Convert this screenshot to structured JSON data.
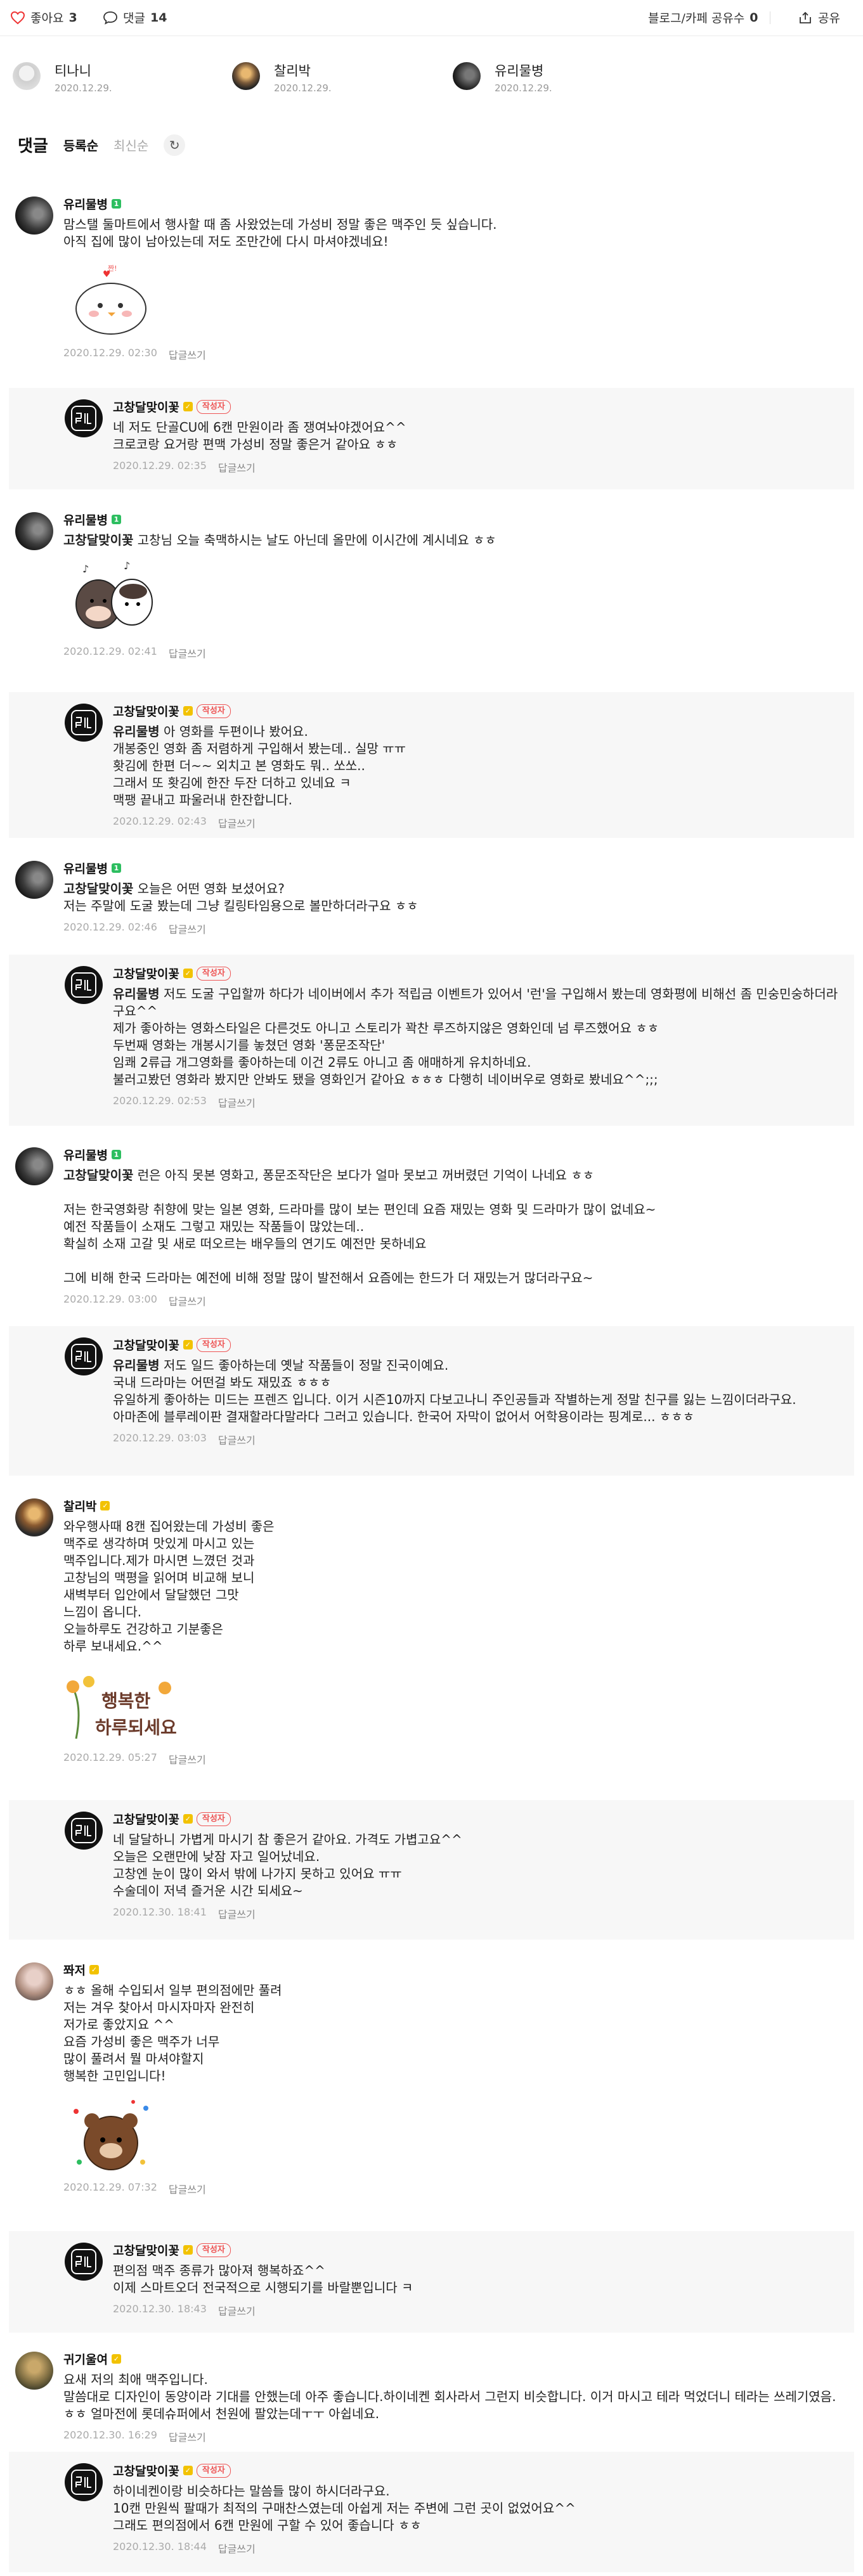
{
  "topbar": {
    "like_label": "좋아요",
    "like_count": "3",
    "comment_label": "댓글",
    "comment_count": "14",
    "share_blog_label": "블로그/카페 공유수",
    "share_blog_count": "0",
    "share_label": "공유"
  },
  "likers": [
    {
      "name": "티나니",
      "date": "2020.12.29."
    },
    {
      "name": "찰리박",
      "date": "2020.12.29."
    },
    {
      "name": "유리물병",
      "date": "2020.12.29."
    }
  ],
  "comments_header": {
    "title": "댓글",
    "sort_active": "등록순",
    "sort_inactive": "최신순"
  },
  "author_badge": "작성자",
  "reply_label": "답글쓰기",
  "comments": [
    {
      "name": "유리물병",
      "text": "맘스탤 둘마트에서 행사할 때 좀 사왔었는데 가성비 정말 좋은 맥주인 듯 싶습니다.\n아직 집에 많이 남아있는데 저도 조만간에 다시 마셔야겠네요!",
      "time": "2020.12.29. 02:30"
    },
    {
      "name": "고창달맞이꽃",
      "text": "네 저도 단골CU에 6캔 만원이라 좀 쟁여놔야겠어요^^\n크로코랑 요거랑 편맥 가성비 정말 좋은거 같아요 ㅎㅎ",
      "time": "2020.12.29. 02:35"
    },
    {
      "name": "유리물병",
      "mention": "고창달맞이꽃",
      "text": " 고창님 오늘 축맥하시는 날도 아닌데 올만에 이시간에 계시네요 ㅎㅎ",
      "time": "2020.12.29. 02:41"
    },
    {
      "name": "고창달맞이꽃",
      "mention": "유리물병",
      "text": " 아 영화를 두편이나 봤어요.\n개봉중인 영화 좀 저렴하게 구입해서 봤는데.. 실망 ㅠㅠ\n홧김에 한편 더~~ 외치고 본 영화도 뭐.. 쏘쏘..\n그래서 또 홧김에 한잔 두잔 더하고 있네요 ㅋ\n맥팽 끝내고 파울러내 한잔합니다.",
      "time": "2020.12.29. 02:43"
    },
    {
      "name": "유리물병",
      "mention": "고창달맞이꽃",
      "text": " 오늘은 어떤 영화 보셨어요?\n저는 주말에 도굴 봤는데 그냥 킬링타임용으로 볼만하더라구요 ㅎㅎ",
      "time": "2020.12.29. 02:46"
    },
    {
      "name": "고창달맞이꽃",
      "mention": "유리물병",
      "text": " 저도 도굴 구입할까 하다가 네이버에서 추가 적립금 이벤트가 있어서 '런'을 구입해서 봤는데 영화평에 비해선 좀 민숭민숭하더라구요^^\n제가 좋아하는 영화스타일은 다른것도 아니고 스토리가 꽉찬 루즈하지않은 영화인데 넘 루즈했어요 ㅎㅎ\n두번째 영화는 개봉시기를 놓쳤던 영화 '퐁문조작단'\n임쾌 2류급 개그영화를 좋아하는데 이건 2류도 아니고 좀 애매하게 유치하네요.\n불러고봤던 영화라 봤지만 안봐도 됐을 영화인거 같아요 ㅎㅎㅎ 다행히 네이버우로 영화로 봤네요^^;;;",
      "time": "2020.12.29. 02:53"
    },
    {
      "name": "유리물병",
      "mention": "고창달맞이꽃",
      "text": " 런은 아직 못본 영화고, 퐁문조작단은 보다가 얼마 못보고 꺼버렸던 기억이 나네요 ㅎㅎ\n\n저는 한국영화랑 취향에 맞는 일본 영화, 드라마를 많이 보는 편인데 요즘 재밌는 영화 및 드라마가 많이 없네요~\n예전 작품들이 소재도 그렇고 재밌는 작품들이 많았는데..\n확실히 소재 고갈 및 새로 떠오르는 배우들의 연기도 예전만 못하네요\n\n그에 비해 한국 드라마는 예전에 비해 정말 많이 발전해서 요즘에는 한드가 더 재밌는거 많더라구요~",
      "time": "2020.12.29. 03:00"
    },
    {
      "name": "고창달맞이꽃",
      "mention": "유리물병",
      "text": " 저도 일드 좋아하는데 옛날 작품들이 정말 진국이예요.\n국내 드라마는 어떤걸 봐도 재밌죠 ㅎㅎㅎ\n유일하게 좋아하는 미드는 프렌즈 입니다. 이거 시즌10까지 다보고나니 주인공들과 작별하는게 정말 친구를 잃는 느낌이더라구요.\n아마존에 블루레이판 결재할라다말라다 그러고 있습니다. 한국어 자막이 없어서 어학용이라는 핑계로... ㅎㅎㅎ",
      "time": "2020.12.29. 03:03"
    },
    {
      "name": "찰리박",
      "text": "와우행사때 8캔 집어왔는데 가성비 좋은\n맥주로 생각하며 맛있게 마시고 있는\n맥주입니다.제가 마시면 느꼈던 것과\n고창님의 맥평을 읽어며 비교해 보니\n새벽부터 입안에서 달달했던 그맛\n느낌이 옵니다.\n오늘하루도 건강하고 기분좋은\n하루 보내세요.^^",
      "sticker_text": "행복한 하루되세요",
      "time": "2020.12.29. 05:27"
    },
    {
      "name": "고창달맞이꽃",
      "text": "네 달달하니 가볍게 마시기 참 좋은거 같아요. 가격도 가볍고요^^\n오늘은 오랜만에 낮잠 자고 일어났네요.\n고창엔 눈이 많이 와서 밖에 나가지 못하고 있어요 ㅠㅠ\n수술데이 저녁 즐거운 시간 되세요~",
      "time": "2020.12.30. 18:41"
    },
    {
      "name": "쫘저",
      "text": "ㅎㅎ 올해 수입되서 일부 편의점에만 풀려\n저는 겨우 찾아서 마시자마자 완전히\n저가로 좋았지요 ^^\n요즘 가성비 좋은 맥주가 너무\n많이 풀려서 뭘 마셔야할지\n행복한 고민입니다!",
      "time": "2020.12.29. 07:32"
    },
    {
      "name": "고창달맞이꽃",
      "text": "편의점 맥주 종류가 많아져 행복하죠^^\n이제 스마트오더 전국적으로 시행되기를 바랄뿐입니다 ㅋ",
      "time": "2020.12.30. 18:43"
    },
    {
      "name": "귀기울여",
      "text": "요새 저의 최애 맥주입니다.\n말씀대로 디자인이 동양이라 기대를 안했는데 아주 좋습니다.하이네켄 회사라서 그런지 비슷합니다. 이거 마시고 테라 먹었더니 테라는 쓰레기였음. ㅎㅎ 얼마전에 롯데슈퍼에서 천원에 팔았는데ㅜㅜ 아쉽네요.",
      "time": "2020.12.30. 16:29"
    },
    {
      "name": "고창달맞이꽃",
      "text": "하이네켄이랑 비슷하다는 말씀들 많이 하시더라구요.\n10캔 만원씩 팔때가 최적의 구매찬스였는데 아쉽게 저는 주변에 그런 곳이 없었어요^^\n그래도 편의점에서 6캔 만원에 구할 수 있어 좋습니다 ㅎㅎ",
      "time": "2020.12.30. 18:44"
    }
  ]
}
